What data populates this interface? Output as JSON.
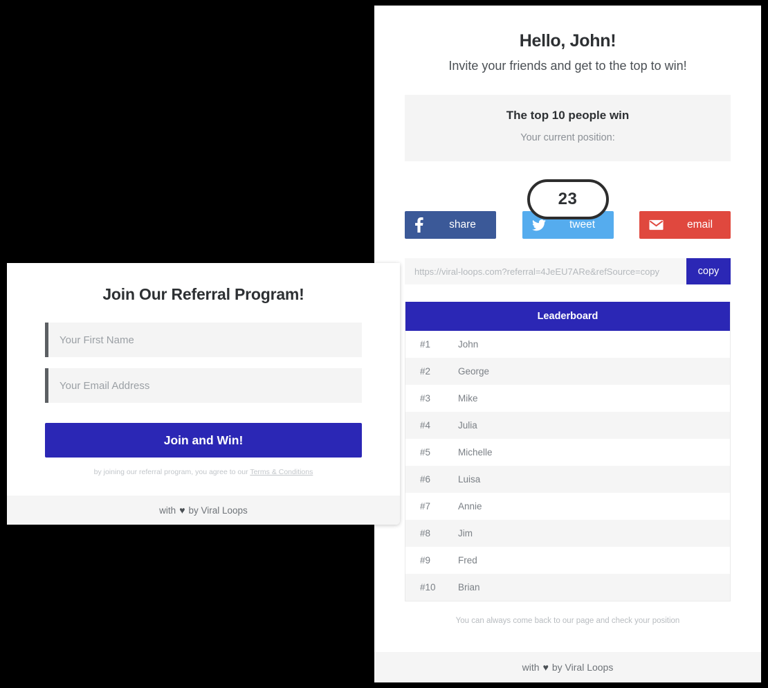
{
  "dashboard": {
    "greeting": "Hello, John!",
    "subgreeting": "Invite your friends and get to the top to win!",
    "position_panel": {
      "title": "The top 10 people win",
      "label": "Your current position:",
      "position": "23"
    },
    "social": {
      "facebook_label": "share",
      "facebook_color": "#3b5998",
      "twitter_label": "tweet",
      "twitter_color": "#55acee",
      "email_label": "email",
      "email_color": "#e0483e"
    },
    "referral": {
      "url": "https://viral-loops.com?referral=4JeEU7ARe&refSource=copy",
      "copy_label": "copy",
      "copy_color": "#2b27b5"
    },
    "leaderboard": {
      "header": "Leaderboard",
      "accent_color": "#2b27b5",
      "rows": [
        {
          "rank": "#1",
          "name": "John"
        },
        {
          "rank": "#2",
          "name": "George"
        },
        {
          "rank": "#3",
          "name": "Mike"
        },
        {
          "rank": "#4",
          "name": "Julia"
        },
        {
          "rank": "#5",
          "name": "Michelle"
        },
        {
          "rank": "#6",
          "name": "Luisa"
        },
        {
          "rank": "#7",
          "name": "Annie"
        },
        {
          "rank": "#8",
          "name": "Jim"
        },
        {
          "rank": "#9",
          "name": "Fred"
        },
        {
          "rank": "#10",
          "name": "Brian"
        }
      ]
    },
    "note": "You can always come back to our page and check your position",
    "footer": {
      "prefix": "with",
      "heart": "♥",
      "suffix": "by Viral Loops"
    }
  },
  "signup": {
    "title": "Join Our Referral Program!",
    "first_name_placeholder": "Your First Name",
    "first_name_value": "",
    "email_placeholder": "Your Email Address",
    "email_value": "",
    "submit_label": "Join and Win!",
    "submit_color": "#2b27b5",
    "terms_text": "by joining our referral program, you agree to our ",
    "terms_link": "Terms & Conditions",
    "footer": {
      "prefix": "with",
      "heart": "♥",
      "suffix": "by Viral Loops"
    }
  }
}
